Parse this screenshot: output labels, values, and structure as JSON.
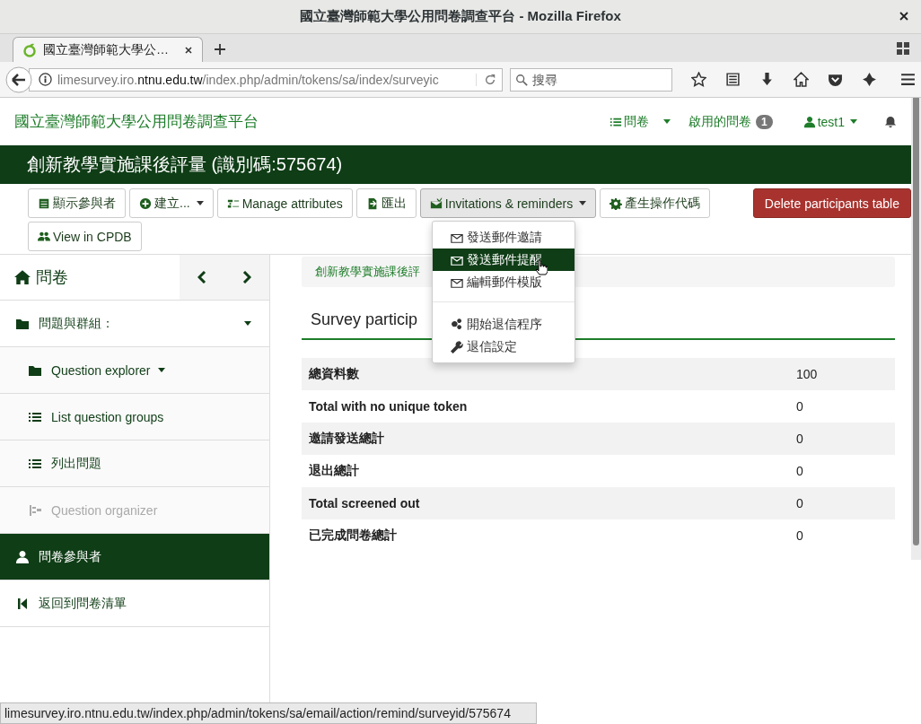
{
  "window": {
    "title": "國立臺灣師範大學公用問卷調查平台 - Mozilla Firefox"
  },
  "browser": {
    "tab": {
      "title": "國立臺灣師範大學公…",
      "selected": true
    },
    "url": {
      "before": "limesurvey.iro.",
      "domain": "ntnu.edu.tw",
      "after": "/index.php/admin/tokens/sa/index/surveyic"
    },
    "search": {
      "placeholder": "搜尋"
    }
  },
  "navbar": {
    "brand": "國立臺灣師範大學公用問卷調查平台",
    "surveys": "問卷",
    "active_surveys": "啟用的問卷",
    "active_count": "1",
    "user": "test1"
  },
  "survey_title": "創新教學實施課後評量 (識別碼:575674)",
  "toolbar": {
    "buttons": [
      {
        "label": "顯示參與者",
        "caret": false,
        "expanded": false
      },
      {
        "label": "建立...",
        "caret": true,
        "expanded": false
      },
      {
        "label": "Manage attributes",
        "caret": false,
        "expanded": false
      },
      {
        "label": "匯出",
        "caret": false,
        "expanded": false
      },
      {
        "label": "Invitations & reminders",
        "caret": true,
        "expanded": true
      },
      {
        "label": "產生操作代碼",
        "caret": false,
        "expanded": false
      },
      {
        "label": "View in CPDB",
        "caret": false,
        "expanded": false
      }
    ],
    "danger_button": "Delete participants table"
  },
  "dropdown": {
    "groups": [
      [
        {
          "label": "發送郵件邀請",
          "selected": false
        },
        {
          "label": "發送郵件提醒",
          "selected": true
        },
        {
          "label": "編輯郵件模版",
          "selected": false
        }
      ],
      [
        {
          "label": "開始退信程序",
          "selected": false
        },
        {
          "label": "退信設定",
          "selected": false
        }
      ]
    ]
  },
  "sidebar": {
    "title": "問卷",
    "items": [
      {
        "label": "問題與群組：",
        "kind": "section",
        "caret": true,
        "selected": false,
        "disabled": false
      },
      {
        "label": "Question explorer",
        "kind": "sub",
        "caret": true,
        "selected": false,
        "disabled": false
      },
      {
        "label": "List question groups",
        "kind": "sub",
        "caret": false,
        "selected": false,
        "disabled": false
      },
      {
        "label": "列出問題",
        "kind": "sub",
        "caret": false,
        "selected": false,
        "disabled": false
      },
      {
        "label": "Question organizer",
        "kind": "sub",
        "caret": false,
        "selected": false,
        "disabled": true
      },
      {
        "label": "問卷參與者",
        "kind": "section",
        "caret": false,
        "selected": true,
        "disabled": false
      },
      {
        "label": "返回到問卷清單",
        "kind": "section",
        "caret": false,
        "selected": false,
        "disabled": false
      }
    ]
  },
  "breadcrumb": "創新教學實施課後評",
  "heading": "Survey particip",
  "summary": [
    {
      "label": "總資料數",
      "value": "100"
    },
    {
      "label": "Total with no unique token",
      "value": "0"
    },
    {
      "label": "邀請發送總計",
      "value": "0"
    },
    {
      "label": "退出總計",
      "value": "0"
    },
    {
      "label": "Total screened out",
      "value": "0"
    },
    {
      "label": "已完成問卷總計",
      "value": "0"
    }
  ],
  "status_bar": "limesurvey.iro.ntnu.edu.tw/index.php/admin/tokens/sa/email/action/remind/surveyid/575674"
}
